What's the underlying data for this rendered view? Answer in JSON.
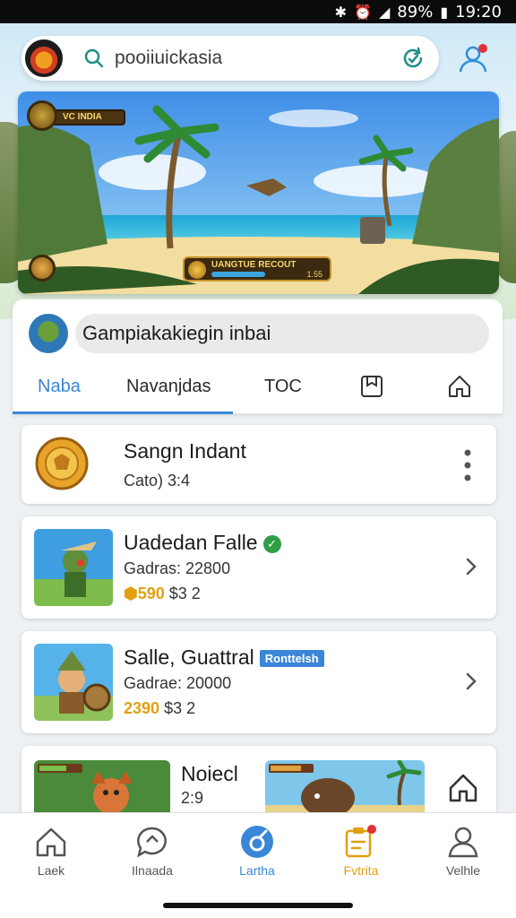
{
  "status": {
    "battery": "89%",
    "time": "19:20"
  },
  "search": {
    "query": "pooiiuickasia"
  },
  "profile": {
    "game_name": "Gampiakakiegin inbai"
  },
  "tabs": [
    {
      "label": "Naba",
      "active": true
    },
    {
      "label": "Navanjdas",
      "active": false
    },
    {
      "label": "TOC",
      "active": false
    }
  ],
  "banner": {
    "hud_label": "VC INDIA",
    "bar_label": "UANGTUE RECOUT",
    "bar_value": "1.55",
    "progress": 0.6
  },
  "cards": [
    {
      "title": "Sangn Indant",
      "sub": "Cato) 3:4"
    },
    {
      "title": "Uadedan Falle",
      "verified": true,
      "sub": "Gadras: 22800",
      "price": "590",
      "extra": "$3 2"
    },
    {
      "title": "Salle, Guattral",
      "tag": "Ronttelsh",
      "sub": "Gadrae: 20000",
      "price": "2390",
      "extra": "$3 2"
    },
    {
      "title": "Noiecl",
      "sub": "2:9"
    }
  ],
  "bottom_nav": [
    {
      "label": "Laek",
      "icon": "home-icon"
    },
    {
      "label": "Ilnaada",
      "icon": "chat-icon"
    },
    {
      "label": "Lartha",
      "icon": "compass-icon",
      "active": true
    },
    {
      "label": "Fvtrita",
      "icon": "clipboard-icon",
      "badge": true
    },
    {
      "label": "Velhle",
      "icon": "user-icon"
    }
  ],
  "colors": {
    "accent": "#3a86d8",
    "gold": "#e0a010",
    "verified": "#2f9e44",
    "badge": "#e0303a"
  }
}
